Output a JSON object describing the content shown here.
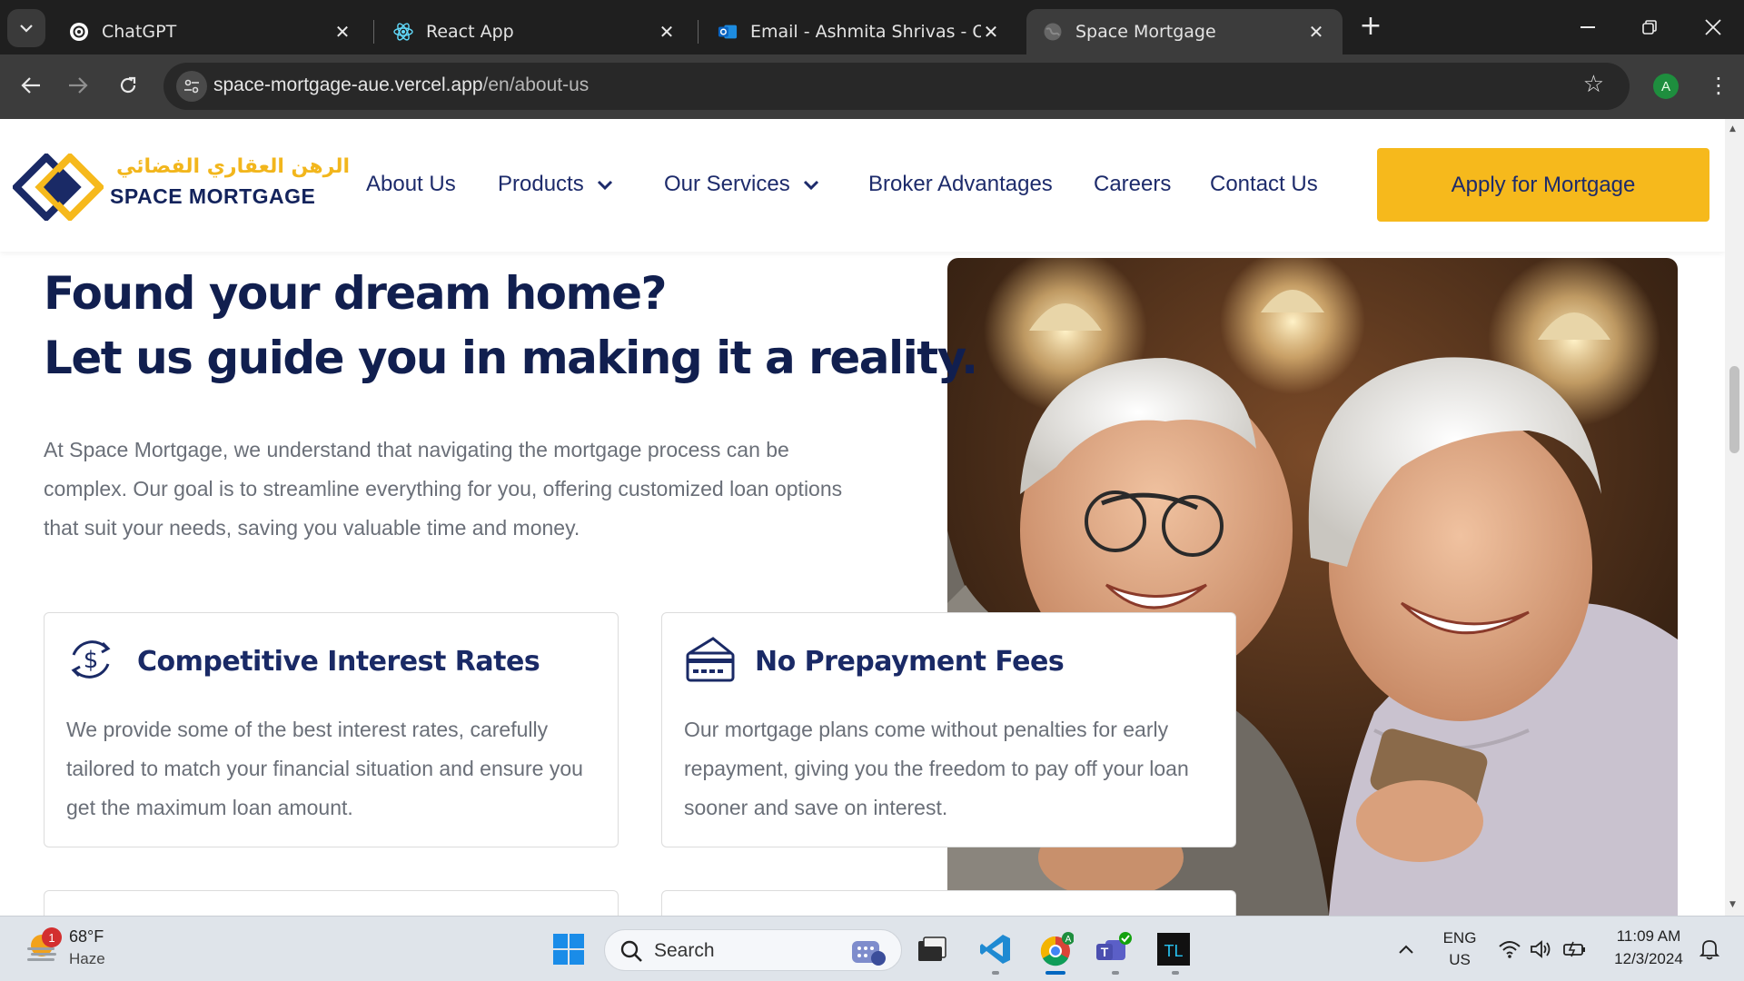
{
  "browser": {
    "tabs": [
      {
        "title": "ChatGPT",
        "icon": "chatgpt-icon"
      },
      {
        "title": "React App",
        "icon": "react-icon"
      },
      {
        "title": "Email - Ashmita Shrivas - Outlo",
        "icon": "outlook-icon"
      },
      {
        "title": "Space Mortgage",
        "icon": "globe-icon",
        "active": true
      }
    ],
    "url_domain": "space-mortgage-aue.vercel.app",
    "url_path": "/en/about-us",
    "profile_initial": "A"
  },
  "site": {
    "logo_arabic": "الرهن العقاري الفضائي",
    "logo_english": "SPACE MORTGAGE",
    "nav": {
      "about": "About Us",
      "products": "Products",
      "services": "Our Services",
      "broker": "Broker Advantages",
      "careers": "Careers",
      "contact": "Contact Us"
    },
    "cta": "Apply for Mortgage",
    "colors": {
      "navy": "#111f4f",
      "accent": "#f6b91c"
    }
  },
  "hero": {
    "title_line1": "Found your dream home?",
    "title_line2": "Let us guide you in making it a reality.",
    "copy": "At Space Mortgage, we understand that navigating the mortgage process can be complex. Our goal is to streamline everything for you, offering customized loan options that suit your needs, saving you valuable time and money."
  },
  "features": [
    {
      "icon": "dollar-cycle-icon",
      "title": "Competitive Interest Rates",
      "body": "We provide some of the best interest rates, carefully tailored to match your financial situation and ensure you get the maximum loan amount."
    },
    {
      "icon": "credit-card-icon",
      "title": "No Prepayment Fees",
      "body": "Our mortgage plans come without penalties for early repayment, giving you the freedom to pay off your loan sooner and save on interest."
    }
  ],
  "taskbar": {
    "weather_temp": "68°F",
    "weather_desc": "Haze",
    "weather_badge": "1",
    "search_label": "Search",
    "lang_line1": "ENG",
    "lang_line2": "US",
    "time": "11:09 AM",
    "date": "12/3/2024"
  }
}
